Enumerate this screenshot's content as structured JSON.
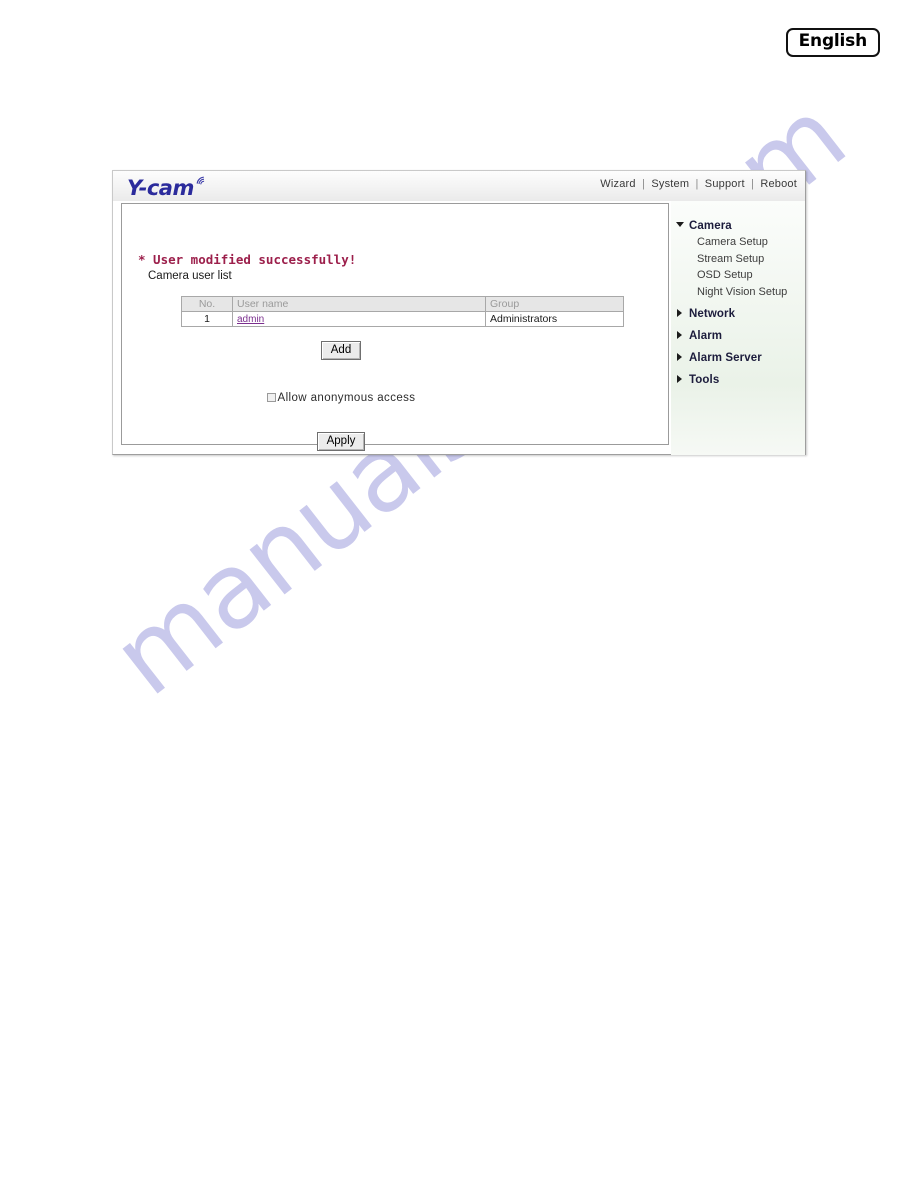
{
  "page": {
    "watermark": "manualshive.com",
    "language_badge": "English"
  },
  "header": {
    "logo_text": "Y-cam",
    "logo_icon": "wifi-arcs-icon",
    "nav": [
      {
        "label": "Wizard"
      },
      {
        "label": "System"
      },
      {
        "label": "Support"
      },
      {
        "label": "Reboot"
      }
    ],
    "nav_separator": "|"
  },
  "content": {
    "success_message": "* User modified successfully!",
    "list_title": "Camera user list",
    "table": {
      "columns": [
        "No.",
        "User name",
        "Group"
      ],
      "rows": [
        {
          "no": "1",
          "user_name": "admin",
          "group": "Administrators"
        }
      ]
    },
    "add_button": "Add",
    "anonymous": {
      "label": "Allow anonymous access",
      "checked": false
    },
    "apply_button": "Apply"
  },
  "sidebar": {
    "groups": [
      {
        "label": "Camera",
        "expanded": true,
        "children": [
          {
            "label": "Camera Setup"
          },
          {
            "label": "Stream Setup"
          },
          {
            "label": "OSD Setup"
          },
          {
            "label": "Night Vision Setup"
          }
        ]
      },
      {
        "label": "Network",
        "expanded": false,
        "children": []
      },
      {
        "label": "Alarm",
        "expanded": false,
        "children": []
      },
      {
        "label": "Alarm Server",
        "expanded": false,
        "children": []
      },
      {
        "label": "Tools",
        "expanded": false,
        "children": []
      }
    ]
  },
  "colors": {
    "logo_blue": "#2b2b9c",
    "success_red": "#9c1f4b",
    "link_purple": "#7b2f8e",
    "watermark": "#c9c9ec"
  }
}
